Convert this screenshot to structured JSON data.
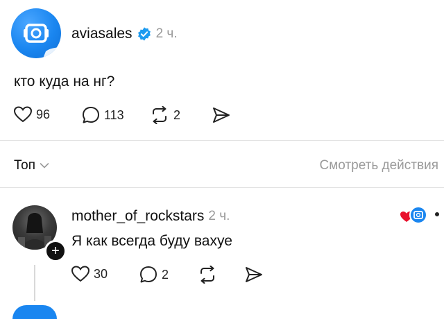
{
  "post": {
    "author": "aviasales",
    "time": "2 ч.",
    "text": "кто куда на нг?",
    "likes": "96",
    "comments": "113",
    "reposts": "2",
    "colors": {
      "verified": "#1d9bf0",
      "avatar": "#1a86f0"
    }
  },
  "replies_header": {
    "sort_label": "Топ",
    "view_activity": "Смотреть действия"
  },
  "reply": {
    "author": "mother_of_rockstars",
    "time": "2 ч.",
    "text": "Я как всегда буду вахуе",
    "likes": "30",
    "comments": "2"
  }
}
